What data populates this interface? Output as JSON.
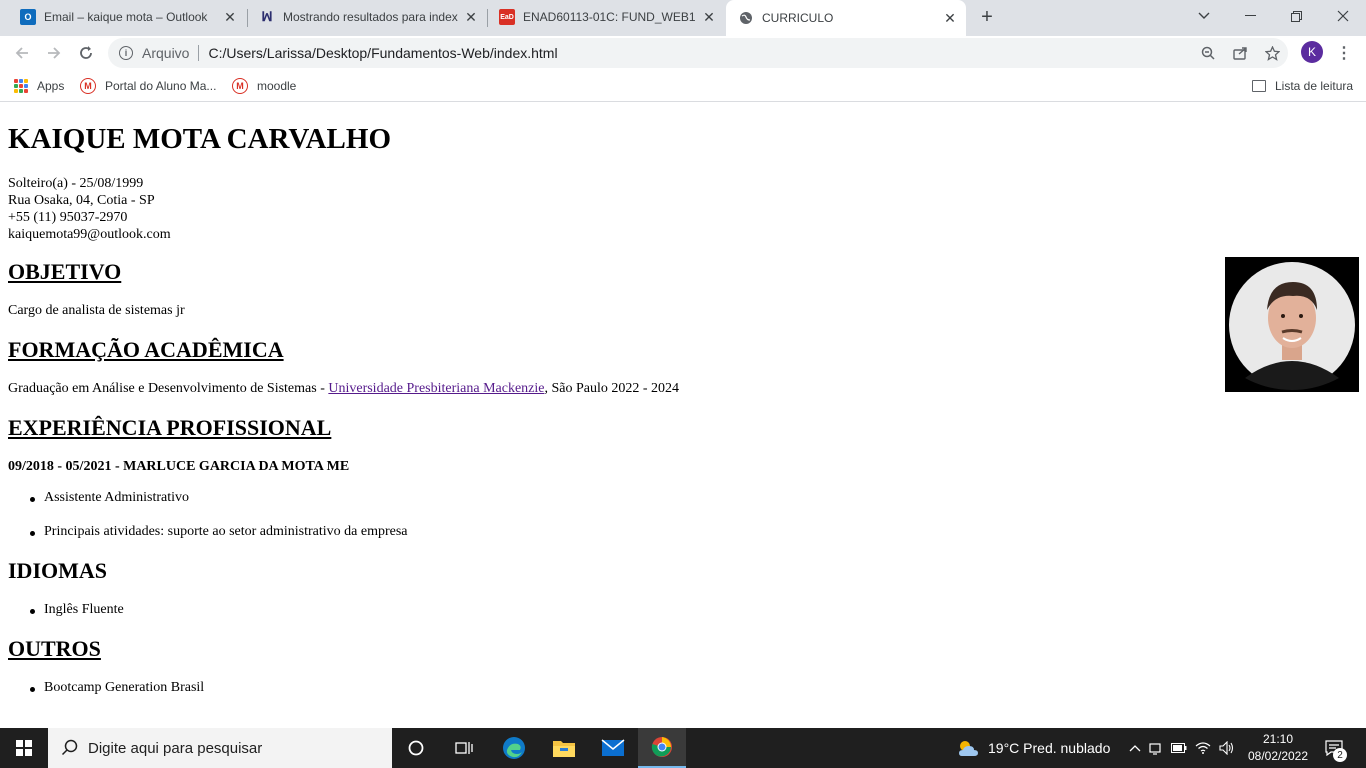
{
  "browser": {
    "tabs": [
      {
        "title": "Email – kaique mota – Outlook",
        "icon": "outlook-icon"
      },
      {
        "title": "Mostrando resultados para index",
        "icon": "mackenzie-icon"
      },
      {
        "title": "ENAD60113-01C: FUND_WEB1 - ",
        "icon": "ead-icon"
      },
      {
        "title": "CURRICULO",
        "icon": "globe-icon"
      }
    ],
    "active_tab": 3,
    "omnibox": {
      "scheme_label": "Arquivo",
      "url": "C:/Users/Larissa/Desktop/Fundamentos-Web/index.html"
    },
    "profile_initial": "K",
    "bookmarks": [
      {
        "label": "Apps",
        "icon": "apps-grid-icon"
      },
      {
        "label": "Portal do Aluno Ma...",
        "icon": "mackenzie-m-icon"
      },
      {
        "label": "moodle",
        "icon": "mackenzie-m-icon"
      }
    ],
    "reading_list_label": "Lista de leitura"
  },
  "resume": {
    "name": "KAIQUE MOTA CARVALHO",
    "contact": {
      "status_birth": "Solteiro(a) - 25/08/1999",
      "address": "Rua Osaka, 04, Cotia - SP",
      "phone": "+55 (11) 95037-2970",
      "email": "kaiquemota99@outlook.com"
    },
    "objective": {
      "heading": "OBJETIVO",
      "text": "Cargo de analista de sistemas jr"
    },
    "education": {
      "heading": "FORMAÇÃO ACADÊMICA",
      "prefix": "Graduação em Análise e Desenvolvimento de Sistemas - ",
      "link": "Universidade Presbiteriana Mackenzie",
      "suffix": ", São Paulo 2022 - 2024"
    },
    "experience": {
      "heading": "EXPERIÊNCIA PROFISSIONAL",
      "entry_title": "09/2018 - 05/2021 - MARLUCE GARCIA DA MOTA ME",
      "items": [
        "Assistente Administrativo",
        "Principais atividades: suporte ao setor administrativo da empresa"
      ]
    },
    "languages": {
      "heading": "IDIOMAS",
      "items": [
        "Inglês Fluente"
      ]
    },
    "others": {
      "heading": "OUTROS",
      "items": [
        "Bootcamp Generation Brasil"
      ]
    }
  },
  "taskbar": {
    "search_placeholder": "Digite aqui para pesquisar",
    "weather": "19°C  Pred. nublado",
    "time": "21:10",
    "date": "08/02/2022",
    "notification_count": "2"
  },
  "colors": {
    "tabstrip": "#dee1e6",
    "link_visited": "#551a8b",
    "profile": "#5b2c9f",
    "taskbar": "#1f1f1f"
  }
}
